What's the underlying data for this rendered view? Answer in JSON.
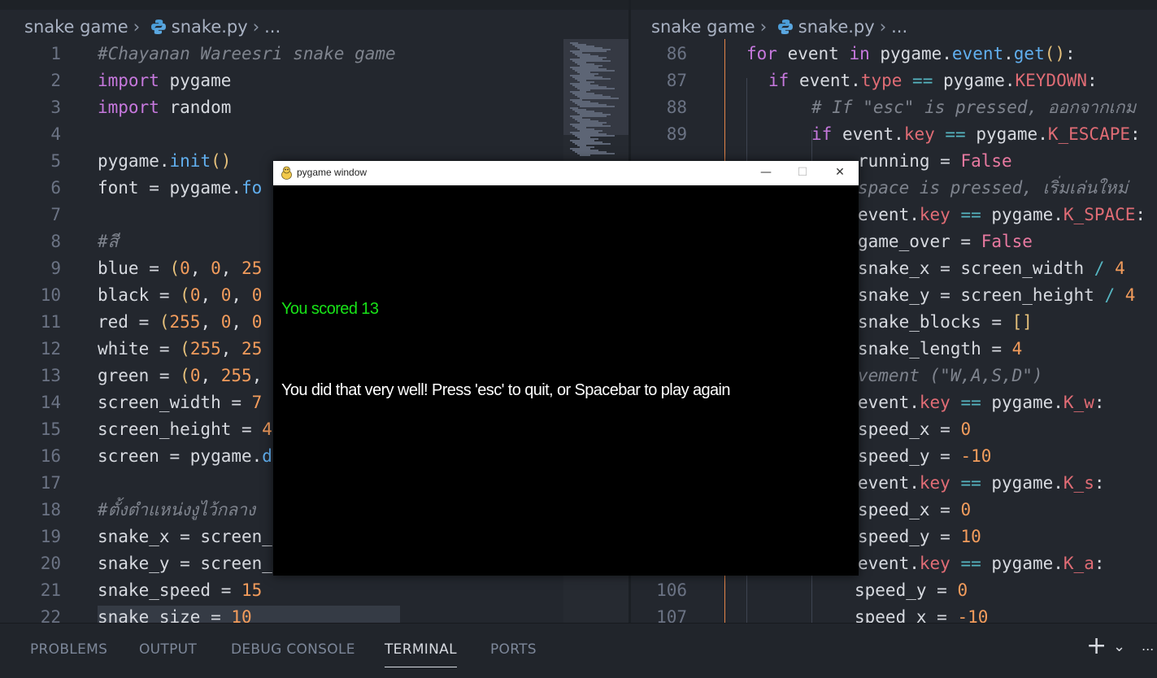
{
  "left_editor": {
    "breadcrumb": {
      "folder": "snake game",
      "file": "snake.py",
      "more": "..."
    },
    "lines": [
      {
        "n": "1",
        "html": "<span class='cm'>#Chayanan Wareesri snake game</span>"
      },
      {
        "n": "2",
        "html": "<span class='kw'>import</span> pygame"
      },
      {
        "n": "3",
        "html": "<span class='kw'>import</span> random"
      },
      {
        "n": "4",
        "html": ""
      },
      {
        "n": "5",
        "html": "pygame.<span class='fn'>init</span><span class='paren'>()</span>"
      },
      {
        "n": "6",
        "html": "font = pygame.<span class='fn'>fo</span>"
      },
      {
        "n": "7",
        "html": ""
      },
      {
        "n": "8",
        "html": "<span class='cm'>#สี</span>"
      },
      {
        "n": "9",
        "html": "blue = <span class='paren'>(</span><span class='num'>0</span>, <span class='num'>0</span>, <span class='num'>25</span>"
      },
      {
        "n": "10",
        "html": "black = <span class='paren'>(</span><span class='num'>0</span>, <span class='num'>0</span>, <span class='num'>0</span>"
      },
      {
        "n": "11",
        "html": "red = <span class='paren'>(</span><span class='num'>255</span>, <span class='num'>0</span>, <span class='num'>0</span>"
      },
      {
        "n": "12",
        "html": "white = <span class='paren'>(</span><span class='num'>255</span>, <span class='num'>25</span>"
      },
      {
        "n": "13",
        "html": "green = <span class='paren'>(</span><span class='num'>0</span>, <span class='num'>255</span>,"
      },
      {
        "n": "14",
        "html": "screen_width = <span class='num'>7</span>"
      },
      {
        "n": "15",
        "html": "screen_height = <span class='num'>4</span>"
      },
      {
        "n": "16",
        "html": "screen = pygame.<span class='fn'>d</span>"
      },
      {
        "n": "17",
        "html": ""
      },
      {
        "n": "18",
        "html": "<span class='cm'>#ตั้งตำแหน่งงูไว้กลาง</span>"
      },
      {
        "n": "19",
        "html": "snake_x = screen_"
      },
      {
        "n": "20",
        "html": "snake_y = screen_"
      },
      {
        "n": "21",
        "html": "snake_speed = <span class='num'>15</span>"
      },
      {
        "n": "22",
        "html": "snake_size = <span class='num'>10</span>"
      }
    ]
  },
  "right_editor": {
    "breadcrumb": {
      "folder": "snake game",
      "file": "snake.py",
      "more": "..."
    },
    "lines": [
      {
        "n": "86",
        "indent": 0,
        "html": "<span class='kw'>for</span> event <span class='kw'>in</span> pygame.<span class='fn'>event</span>.<span class='fn'>get</span><span class='paren'>()</span>:"
      },
      {
        "n": "87",
        "indent": 1,
        "html": "<span class='kw'>if</span> event.<span class='prop'>type</span> <span class='op'>==</span> pygame.<span class='prop'>KEYDOWN</span>:"
      },
      {
        "n": "88",
        "indent": 2,
        "html": "<span class='cm'># If \"esc\" is pressed, ออกจากเกม</span>"
      },
      {
        "n": "89",
        "indent": 2,
        "html": "<span class='kw'>if</span> event.<span class='prop'>key</span> <span class='op'>==</span> pygame.<span class='prop'>K_ESCAPE</span>:"
      },
      {
        "n": "",
        "indent": 3,
        "html": "running = <span class='bool'>False</span>"
      },
      {
        "n": "",
        "indent": 3,
        "html": "<span class='cm'>space is pressed, เริ่มเล่นใหม่</span>"
      },
      {
        "n": "",
        "indent": 3,
        "html": "event.<span class='prop'>key</span> <span class='op'>==</span> pygame.<span class='prop'>K_SPACE</span>:"
      },
      {
        "n": "",
        "indent": 3,
        "html": "game_over = <span class='bool'>False</span>"
      },
      {
        "n": "",
        "indent": 3,
        "html": "snake_x = screen_width <span class='op'>/</span> <span class='num'>4</span>"
      },
      {
        "n": "",
        "indent": 3,
        "html": "snake_y = screen_height <span class='op'>/</span> <span class='num'>4</span>"
      },
      {
        "n": "",
        "indent": 3,
        "html": "snake_blocks = <span class='paren'>[]</span>"
      },
      {
        "n": "",
        "indent": 3,
        "html": "snake_length = <span class='num'>4</span>"
      },
      {
        "n": "",
        "indent": 3,
        "html": "<span class='cm'>vement (\"W,A,S,D\")</span>"
      },
      {
        "n": "",
        "indent": 3,
        "html": "event.<span class='prop'>key</span> <span class='op'>==</span> pygame.<span class='prop'>K_w</span>:"
      },
      {
        "n": "",
        "indent": 3,
        "html": "speed_x = <span class='num'>0</span>"
      },
      {
        "n": "",
        "indent": 3,
        "html": "speed_y = <span class='num'>-10</span>"
      },
      {
        "n": "",
        "indent": 3,
        "html": "event.<span class='prop'>key</span> <span class='op'>==</span> pygame.<span class='prop'>K_s</span>:"
      },
      {
        "n": "",
        "indent": 3,
        "html": "speed_x = <span class='num'>0</span>"
      },
      {
        "n": "",
        "indent": 3,
        "html": "speed_y = <span class='num'>10</span>"
      },
      {
        "n": "",
        "indent": 3,
        "html": "event.<span class='prop'>key</span> <span class='op'>==</span> pygame.<span class='prop'>K_a</span>:"
      },
      {
        "n": "106",
        "indent": 3,
        "html": "speed_y = <span class='num'>0</span>"
      },
      {
        "n": "107",
        "indent": 3,
        "html": "speed_x = <span class='num'>-10</span>"
      }
    ]
  },
  "panel": {
    "tabs": [
      "PROBLEMS",
      "OUTPUT",
      "DEBUG CONSOLE",
      "TERMINAL",
      "PORTS"
    ],
    "active_tab": "TERMINAL",
    "add_icon": "+",
    "dropdown_icon": "⌄",
    "more_icon": "..."
  },
  "pygame_window": {
    "title": "pygame window",
    "minimize": "—",
    "maximize": "☐",
    "close": "✕",
    "score_text": "You scored 13",
    "message_text": "You did that very well! Press 'esc' to quit, or Spacebar to play again"
  }
}
